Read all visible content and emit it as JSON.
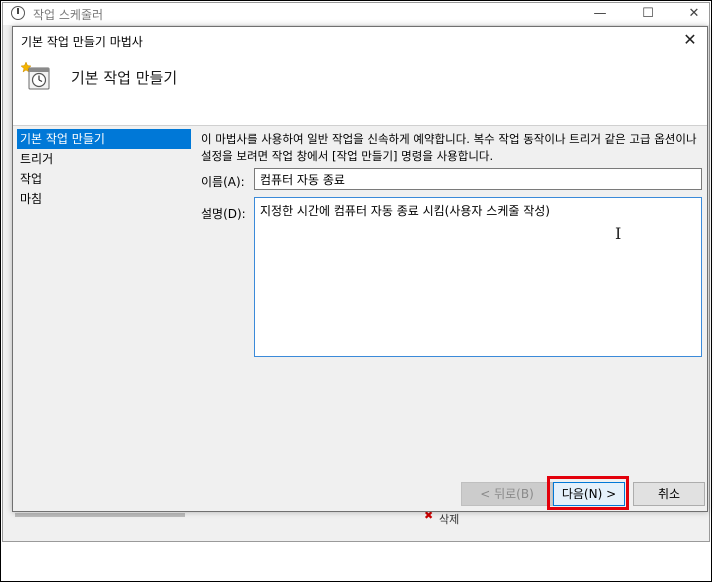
{
  "background_window": {
    "title": "작업 스케줄러",
    "minimize": "—",
    "maximize": "☐",
    "close": "✕",
    "delete_label": "삭제"
  },
  "dialog": {
    "title": "기본 작업 만들기 마법사",
    "close": "✕",
    "header_title": "기본 작업 만들기",
    "sidebar": [
      {
        "label": "기본 작업 만들기",
        "active": true
      },
      {
        "label": "트리거",
        "active": false
      },
      {
        "label": "작업",
        "active": false
      },
      {
        "label": "마침",
        "active": false
      }
    ],
    "description": "이 마법사를 사용하여 일반 작업을 신속하게 예약합니다. 복수 작업 동작이나 트리거 같은 고급 옵션이나 설정을 보려면 작업 창에서 [작업 만들기] 명령을 사용합니다.",
    "name_label": "이름(A):",
    "name_value": "컴퓨터 자동 종료",
    "desc_label": "설명(D):",
    "desc_value": "지정한 시간에 컴퓨터 자동 종료 시킴(사용자 스케줄 작성)",
    "buttons": {
      "back": "< 뒤로(B)",
      "next": "다음(N) >",
      "cancel": "취소"
    }
  },
  "colors": {
    "selection": "#0078d7",
    "highlight": "#e3000b"
  }
}
